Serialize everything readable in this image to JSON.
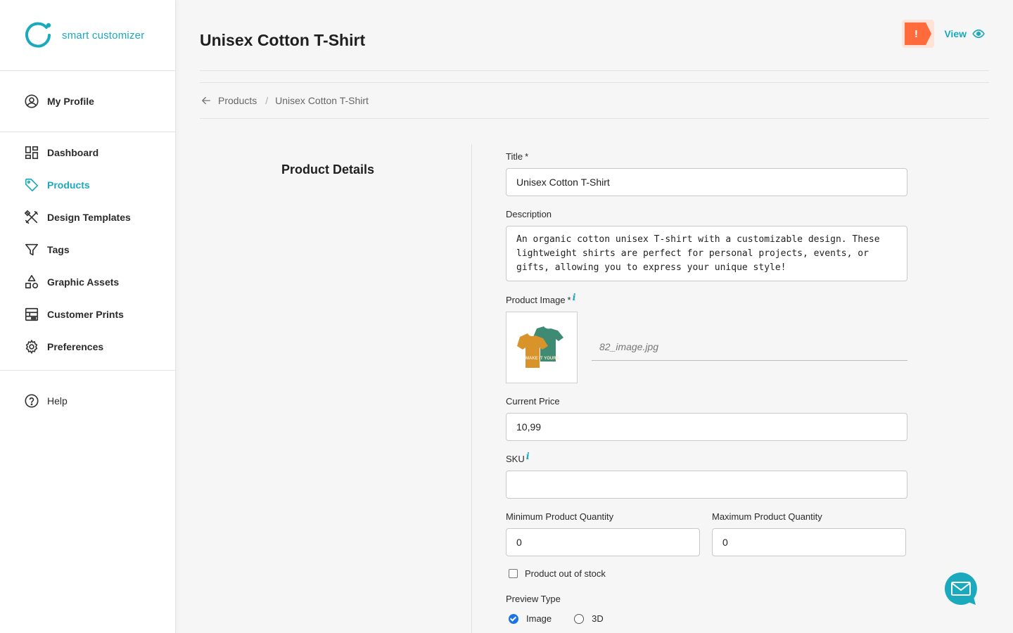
{
  "brand": {
    "name": "smart customizer",
    "accent": "#1ba9bd"
  },
  "sidebar": {
    "profile": {
      "label": "My Profile",
      "icon": "user-circle-icon"
    },
    "items": [
      {
        "label": "Dashboard",
        "icon": "dashboard-icon"
      },
      {
        "label": "Products",
        "icon": "tag-icon",
        "active": true
      },
      {
        "label": "Design Templates",
        "icon": "design-tools-icon"
      },
      {
        "label": "Tags",
        "icon": "filter-icon"
      },
      {
        "label": "Graphic Assets",
        "icon": "shapes-icon"
      },
      {
        "label": "Customer Prints",
        "icon": "prints-icon"
      },
      {
        "label": "Preferences",
        "icon": "gear-icon"
      }
    ],
    "help": {
      "label": "Help",
      "icon": "question-circle-icon"
    }
  },
  "header": {
    "title": "Unisex Cotton T-Shirt",
    "alert_badge": "!",
    "view_label": "View"
  },
  "breadcrumb": {
    "parent": "Products",
    "separator": "/",
    "current": "Unisex Cotton T-Shirt"
  },
  "section": {
    "title": "Product Details"
  },
  "form": {
    "title_label": "Title",
    "title_required": "*",
    "title_value": "Unisex Cotton T-Shirt",
    "description_label": "Description",
    "description_value": "An organic cotton unisex T-shirt with a customizable design. These\nlightweight shirts are perfect for personal projects, events, or\ngifts, allowing you to express your unique style!",
    "image_label": "Product Image",
    "image_required": "*",
    "info_glyph": "i",
    "image_filename": "82_image.jpg",
    "thumbnail_text": "MAKE IT YOURS.",
    "price_label": "Current Price",
    "price_value": "10,99",
    "sku_label": "SKU",
    "sku_value": "",
    "min_qty_label": "Minimum Product Quantity",
    "min_qty_value": "0",
    "max_qty_label": "Maximum Product Quantity",
    "max_qty_value": "0",
    "out_of_stock_label": "Product out of stock",
    "out_of_stock_checked": false,
    "preview_type_label": "Preview Type",
    "preview_options": [
      "Image",
      "3D"
    ],
    "preview_selected": "Image"
  },
  "colors": {
    "alert": "#ff6b3d",
    "radio_selected": "#1a73e8"
  }
}
